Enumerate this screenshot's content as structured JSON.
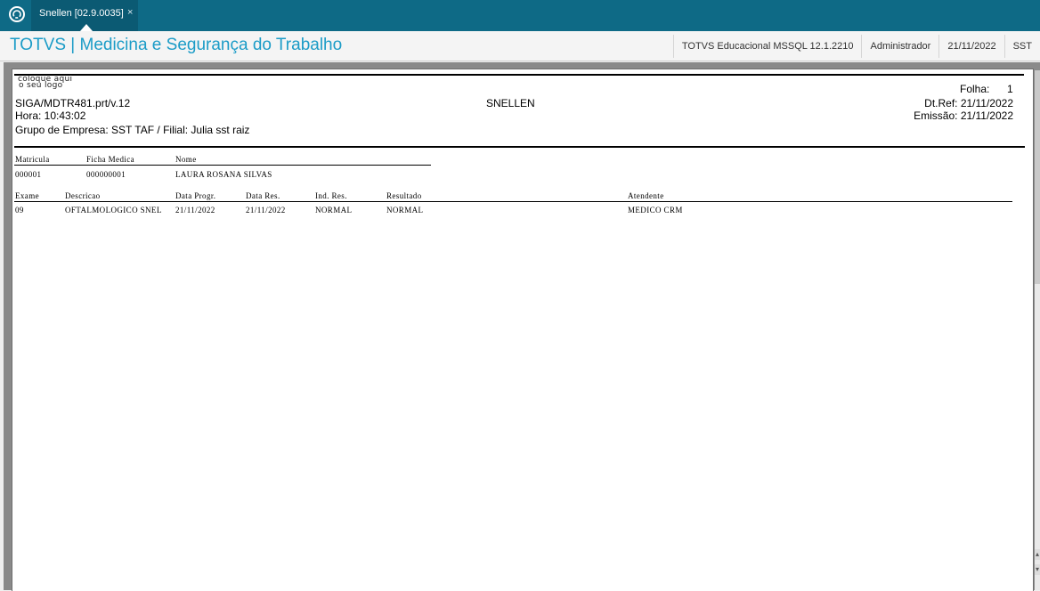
{
  "topbar": {
    "logo_icon": "totvs-logo-icon",
    "tab": {
      "label": "Snellen [02.9.0035]",
      "close": "×"
    }
  },
  "header": {
    "title": "TOTVS | Medicina e Segurança do Trabalho",
    "environment": "TOTVS Educacional MSSQL 12.1.2210",
    "user": "Administrador",
    "date": "21/11/2022",
    "company": "SST"
  },
  "report": {
    "logo_placeholder_line1": "coloque aqui",
    "logo_placeholder_line2": "o seu logo",
    "folha_label": "Folha:",
    "folha_value": "1",
    "program": "SIGA/MDTR481.prt/v.12",
    "title": "SNELLEN",
    "dtref": "Dt.Ref: 21/11/2022",
    "hora": "Hora: 10:43:02",
    "emissao": "Emissão: 21/11/2022",
    "grupo": "Grupo de Empresa: SST TAF / Filial: Julia sst raiz",
    "employee_headers": {
      "matricula": "Matricula",
      "ficha": "Ficha Medica",
      "nome": "Nome"
    },
    "employee": {
      "matricula": "000001",
      "ficha": "000000001",
      "nome": "LAURA ROSANA SILVAS"
    },
    "exam_headers": {
      "exame": "Exame",
      "descricao": "Descricao",
      "data_progr": "Data Progr.",
      "data_res": "Data Res.",
      "ind_res": "Ind. Res.",
      "resultado": "Resultado",
      "atendente": "Atendente"
    },
    "exam": {
      "exame": "09",
      "descricao": "OFTALMOLOGICO SNEL",
      "data_progr": "21/11/2022",
      "data_res": "21/11/2022",
      "ind_res": "NORMAL",
      "resultado": "NORMAL",
      "atendente": "MEDICO CRM"
    }
  }
}
